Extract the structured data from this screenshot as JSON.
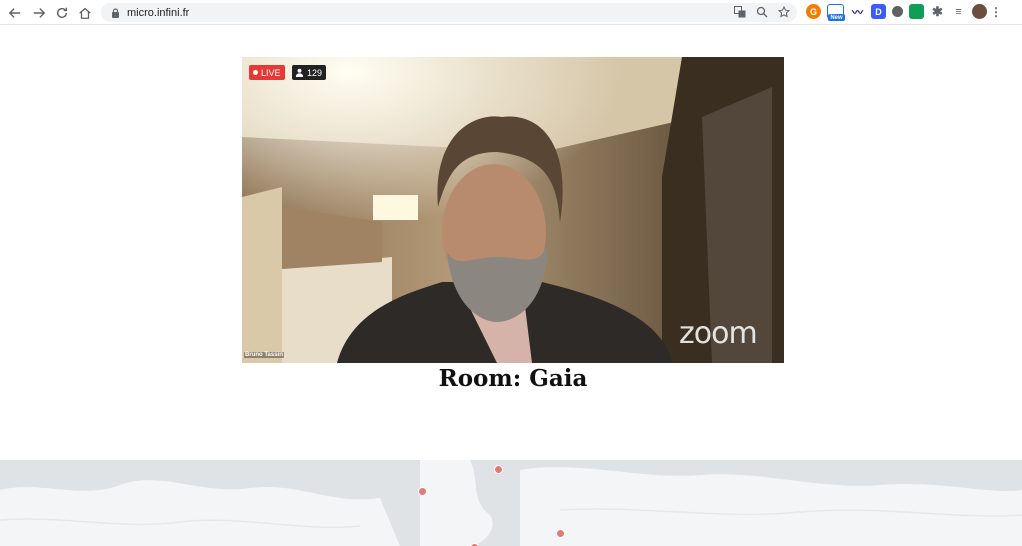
{
  "browser": {
    "url": "micro.infini.fr",
    "ext_new_badge": "New",
    "ext_d_label": "D"
  },
  "video": {
    "live_label": "LIVE",
    "viewer_count": "129",
    "watermark": "zoom",
    "participant_name": "Bruno Tassin"
  },
  "room": {
    "title": "Room: Gaia"
  },
  "map": {
    "marker_color": "#e07a74"
  }
}
